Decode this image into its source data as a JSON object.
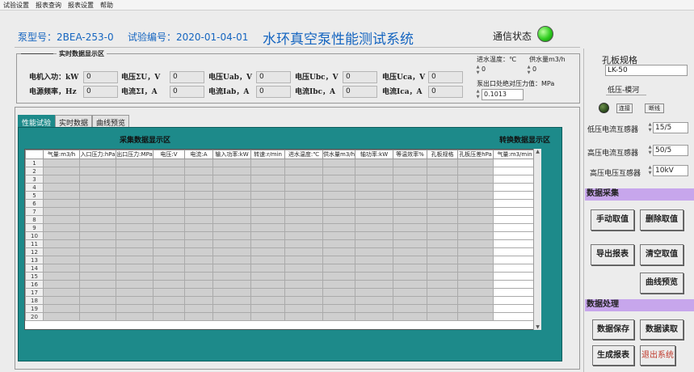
{
  "menu": [
    "试验设置",
    "报表查询",
    "报表设置",
    "帮助"
  ],
  "header": {
    "pump_model": "泵型号：2BEA-253-0",
    "test_number": "试验编号：2020-01-04-01",
    "title": "水环真空泵性能测试系统",
    "comm_status_label": "通信状态",
    "comm_status_color": "#2ecc1f"
  },
  "realtime": {
    "label": "实时数据显示区",
    "row1": [
      {
        "label": "电机入功：kW",
        "value": "0"
      },
      {
        "label": "电压ΣU，V",
        "value": "0"
      },
      {
        "label": "电压Uab，V",
        "value": "0"
      },
      {
        "label": "电压Ubc，V",
        "value": "0"
      },
      {
        "label": "电压Uca，V",
        "value": "0"
      }
    ],
    "row2": [
      {
        "label": "电源频率，Hz",
        "value": "0"
      },
      {
        "label": "电流ΣI，A",
        "value": "0"
      },
      {
        "label": "电流Iab，A",
        "value": "0"
      },
      {
        "label": "电流Ibc，A",
        "value": "0"
      },
      {
        "label": "电流Ica，A",
        "value": "0"
      }
    ],
    "inlet_temp_label": "进水温度：℃",
    "inlet_temp_value": "0",
    "water_supply_label": "供水量m3/h",
    "water_supply_value": "0",
    "outlet_pressure_label": "泵出口处绝对压力值：MPa",
    "outlet_pressure_value": "0.1013"
  },
  "tabs": [
    "性能试验",
    "实时数据",
    "曲线预览"
  ],
  "collect_label": "采集数据显示区",
  "convert_label": "转换数据显示区",
  "table": {
    "headers": [
      "气量:m3/h",
      "入口压力:hPa",
      "出口压力:MPa",
      "电压:V",
      "电流:A",
      "输入功率:kW",
      "转速:r/min",
      "进水温度:℃",
      "供水量m3/h",
      "轴功率:kW",
      "等温效率%",
      "孔板规格",
      "孔板压差hPa",
      "气量:m3/min"
    ],
    "rows": [
      "1",
      "2",
      "3",
      "4",
      "5",
      "6",
      "7",
      "8",
      "9",
      "10",
      "11",
      "12",
      "13",
      "14",
      "15",
      "16",
      "17",
      "18",
      "19",
      "20"
    ]
  },
  "right": {
    "orifice_label": "孔板规格",
    "orifice_value": "LK-50",
    "mode_label": "低压-模河",
    "connect_button": "连接",
    "disconnect_button": "断线",
    "transformers": [
      {
        "label": "低压电流互感器",
        "value": "15/5"
      },
      {
        "label": "高压电流互感器",
        "value": "50/5"
      },
      {
        "label": "高压电压互感器",
        "value": "10kV"
      }
    ],
    "acq_section": "数据采集",
    "proc_section": "数据处理",
    "buttons": {
      "manual": "手动取值",
      "delete": "删除取值",
      "export": "导出报表",
      "clear": "清空取值",
      "curve": "曲线预览",
      "save": "数据保存",
      "read": "数据读取",
      "report": "生成报表",
      "exit": "退出系统"
    },
    "led_color": "#2f4f1f",
    "exit_color": "#c0392b"
  }
}
